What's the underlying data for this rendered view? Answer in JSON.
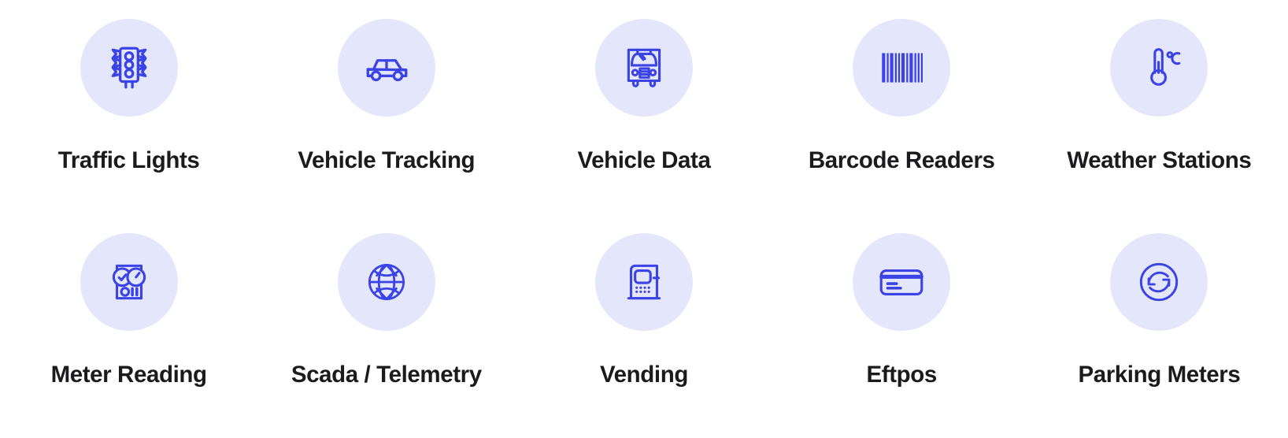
{
  "theme": {
    "background": "#ffffff",
    "disc_background": "#e4e6fb",
    "icon_color": "#3b43e6",
    "label_color": "#1b1b1d"
  },
  "grid": {
    "columns": 5,
    "rows": 2
  },
  "items": [
    {
      "id": "traffic-lights",
      "label": "Traffic Lights",
      "icon": "traffic-light-icon"
    },
    {
      "id": "vehicle-tracking",
      "label": "Vehicle Tracking",
      "icon": "car-icon"
    },
    {
      "id": "vehicle-data",
      "label": "Vehicle Data",
      "icon": "bus-front-icon"
    },
    {
      "id": "barcode-readers",
      "label": "Barcode Readers",
      "icon": "barcode-icon"
    },
    {
      "id": "weather-stations",
      "label": "Weather Stations",
      "icon": "thermometer-celsius-icon"
    },
    {
      "id": "meter-reading",
      "label": "Meter Reading",
      "icon": "utility-meter-icon"
    },
    {
      "id": "scada-telemetry",
      "label": "Scada / Telemetry",
      "icon": "globe-icon"
    },
    {
      "id": "vending",
      "label": "Vending",
      "icon": "vending-machine-icon"
    },
    {
      "id": "eftpos",
      "label": "Eftpos",
      "icon": "credit-card-icon"
    },
    {
      "id": "parking-meters",
      "label": "Parking Meters",
      "icon": "refresh-circle-icon"
    }
  ]
}
